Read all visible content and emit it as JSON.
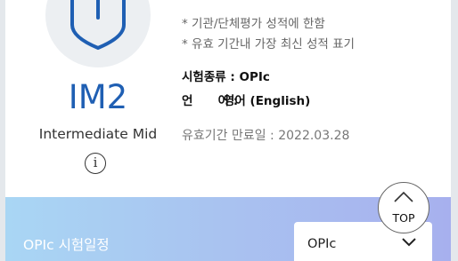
{
  "result": {
    "grade": "IM2",
    "grade_name": "Intermediate Mid",
    "info_icon": "info-icon",
    "badge_icon": "shield-icon",
    "notes": [
      "* 기관/단체평가 성적에 한함",
      "* 유효 기간내 가장 최신 성적 표기"
    ],
    "exam_type_label": "시험종류 : ",
    "exam_type_value": "OPIc",
    "language_label": "언      어 : ",
    "language_value": "영어 (English)",
    "expiry": "유효기간 만료일 : 2022.03.28"
  },
  "schedule": {
    "title": "OPIc 시험일정",
    "select_value": "OPIc"
  },
  "top_button": {
    "label": "TOP"
  },
  "colors": {
    "accent": "#1f5fb3",
    "band_start": "#a9d6f4",
    "band_end": "#a7b0ee"
  }
}
